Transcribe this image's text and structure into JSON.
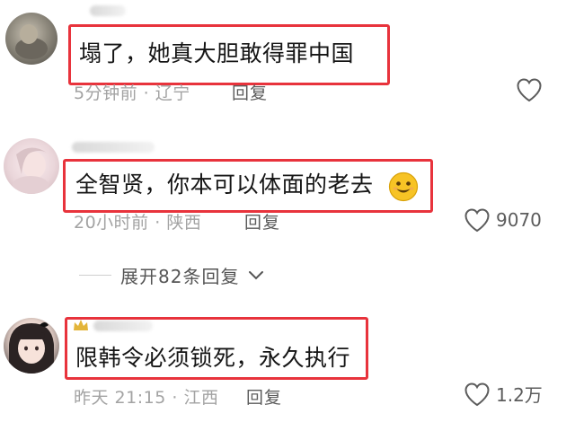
{
  "comments": [
    {
      "text": "塌了，她真大胆敢得罪中国",
      "time": "5分钟前",
      "location": "辽宁",
      "reply_label": "回复",
      "likes": ""
    },
    {
      "text": "全智贤，你本可以体面的老去",
      "emoji": "smiling-face",
      "time": "20小时前",
      "location": "陕西",
      "reply_label": "回复",
      "likes": "9070",
      "expand_label": "展开82条回复"
    },
    {
      "text": "限韩令必须锁死，永久执行",
      "time": "昨天 21:15",
      "location": "江西",
      "reply_label": "回复",
      "likes": "1.2万"
    }
  ],
  "separator": "·",
  "colors": {
    "highlight_border": "#e8333c",
    "meta_text": "#a3a3a3",
    "reply_text": "#5c5c5c",
    "emoji_yellow": "#f7c325"
  },
  "icons": [
    "heart-outline-icon",
    "chevron-down-icon",
    "smiling-face-emoji"
  ]
}
